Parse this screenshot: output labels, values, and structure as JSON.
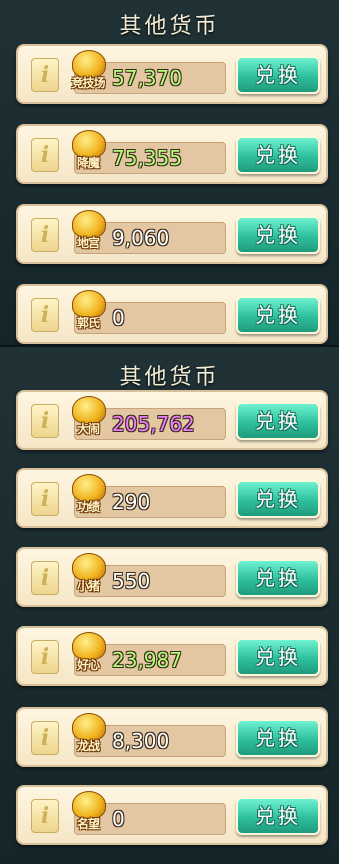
{
  "top_panel": {
    "title": "其他货币",
    "rows": [
      {
        "info": "i",
        "icon": "trophy-crossed-swords-icon",
        "label": "竞技场",
        "amount": "57,370",
        "amount_color": "#b4ff7a",
        "button": "兑换"
      },
      {
        "info": "i",
        "icon": "gold-ingot-icon",
        "label": "降魔",
        "amount": "75,355",
        "amount_color": "#b4ff7a",
        "button": "兑换"
      },
      {
        "info": "i",
        "icon": "gold-spiral-icon",
        "label": "地宫",
        "amount": "9,060",
        "amount_color": "#ffffff",
        "button": "兑换"
      },
      {
        "info": "i",
        "icon": "gold-scroll-icon",
        "label": "郭氏",
        "amount": "0",
        "amount_color": "#ffffff",
        "button": "兑换"
      }
    ]
  },
  "bottom_panel": {
    "title": "其他货币",
    "rows": [
      {
        "info": "i",
        "icon": "gold-cloud-icon",
        "label": "大闹",
        "amount": "205,762",
        "amount_color": "#f07cff",
        "button": "兑换"
      },
      {
        "info": "i",
        "icon": "gold-flag-icon",
        "label": "功绩",
        "amount": "290",
        "amount_color": "#ffffff",
        "button": "兑换"
      },
      {
        "info": "i",
        "icon": "gold-pig-icon",
        "label": "小猪",
        "amount": "550",
        "amount_color": "#ffffff",
        "button": "兑换"
      },
      {
        "info": "i",
        "icon": "gold-heart-icon",
        "label": "好心",
        "amount": "23,987",
        "amount_color": "#b4ff7a",
        "button": "兑换"
      },
      {
        "info": "i",
        "icon": "gold-dragon-icon",
        "label": "龙战",
        "amount": "8,300",
        "amount_color": "#ffffff",
        "button": "兑换"
      },
      {
        "info": "i",
        "icon": "gold-badge-icon",
        "label": "名望",
        "amount": "0",
        "amount_color": "#ffffff",
        "button": "兑换"
      }
    ]
  }
}
